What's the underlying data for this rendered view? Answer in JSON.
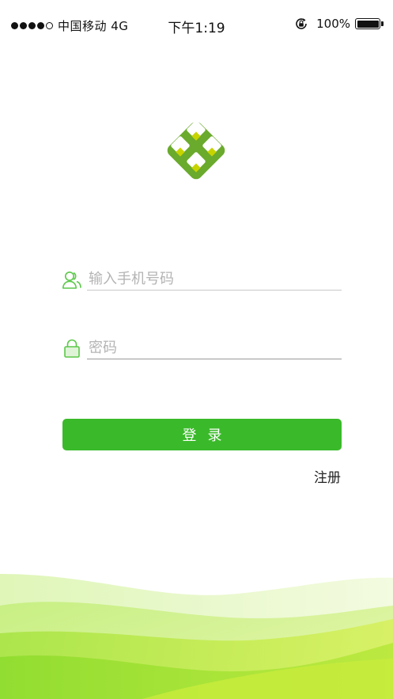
{
  "status_bar": {
    "carrier": "中国移动 4G",
    "time": "下午1:19",
    "battery": "100%",
    "signal_icon": "signal-dots-icon",
    "rotation_icon": "rotation-lock-icon",
    "battery_icon": "battery-icon"
  },
  "logo": {
    "icon": "app-logo-icon"
  },
  "login_form": {
    "phone": {
      "placeholder": "输入手机号码",
      "value": "",
      "icon": "user-icon"
    },
    "password": {
      "placeholder": "密码",
      "value": "",
      "icon": "lock-icon"
    },
    "login_button": "登录",
    "register_link": "注册"
  },
  "colors": {
    "primary": "#3aba2a",
    "icon_green": "#5cc84a",
    "logo_green": "#6aaa2c",
    "logo_accent": "#c8d400",
    "wave_light": "#e7f8c6",
    "wave_bright": "#9ee03a"
  }
}
